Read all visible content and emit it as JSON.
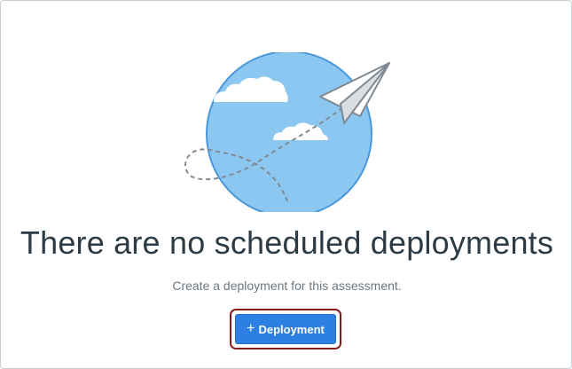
{
  "empty_state": {
    "heading": "There are no scheduled deployments",
    "subtext": "Create a deployment for this assessment.",
    "illustration_icon": "paper-airplane-globe-icon"
  },
  "actions": {
    "add_deployment_label": "Deployment",
    "add_deployment_icon": "plus-icon"
  },
  "colors": {
    "globe": "#8cc7f2",
    "globe_outline": "#4a98dc",
    "button": "#2d7fe1",
    "highlight": "#8b1a1f",
    "heading": "#2d3b45",
    "subtext": "#6b7780"
  }
}
